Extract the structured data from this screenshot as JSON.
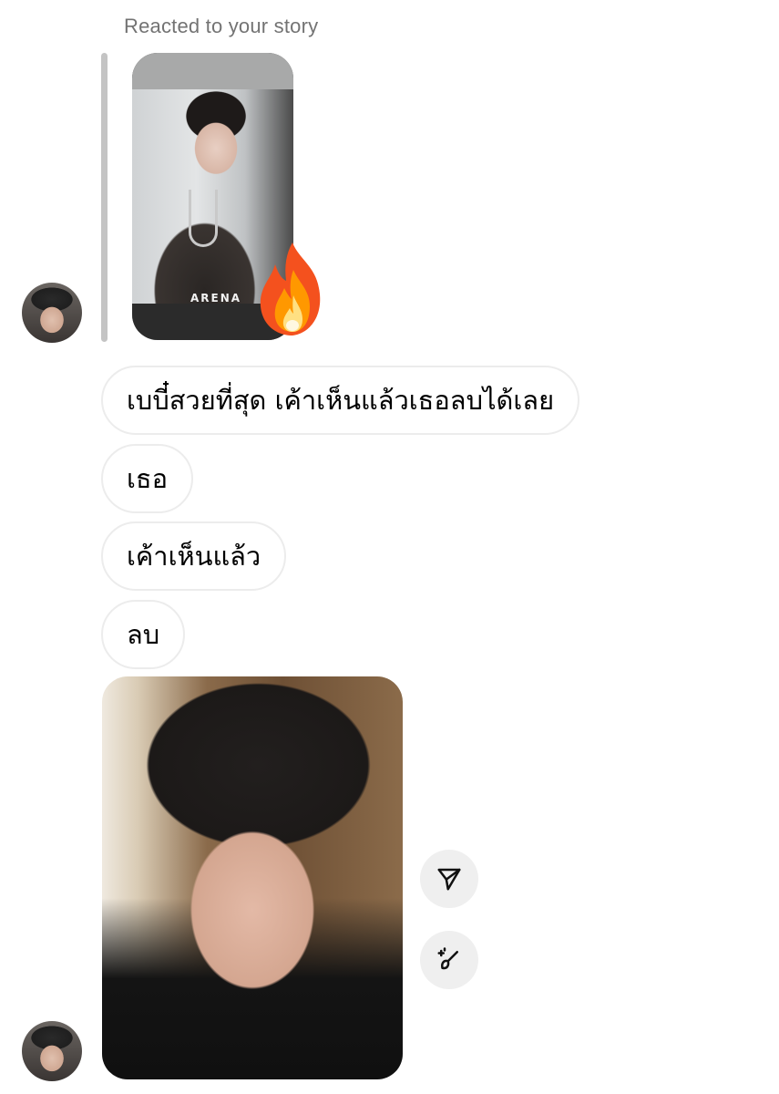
{
  "story_reply": {
    "reacted_label": "Reacted to your story",
    "story_brand_text": "ARENA",
    "reaction_emoji": "fire-emoji"
  },
  "messages": [
    {
      "text": "เบบี๋สวยที่สุด เค้าเห็นแล้วเธอลบได้เลย"
    },
    {
      "text": "เธอ"
    },
    {
      "text": "เค้าเห็นแล้ว"
    },
    {
      "text": "ลบ"
    }
  ],
  "photo_actions": {
    "share_icon": "paper-plane-icon",
    "edit_icon": "magic-brush-icon"
  },
  "colors": {
    "label_gray": "#737373",
    "bubble_border": "#ececec",
    "reply_bar": "#c4c4c4",
    "button_bg": "#efefef"
  }
}
